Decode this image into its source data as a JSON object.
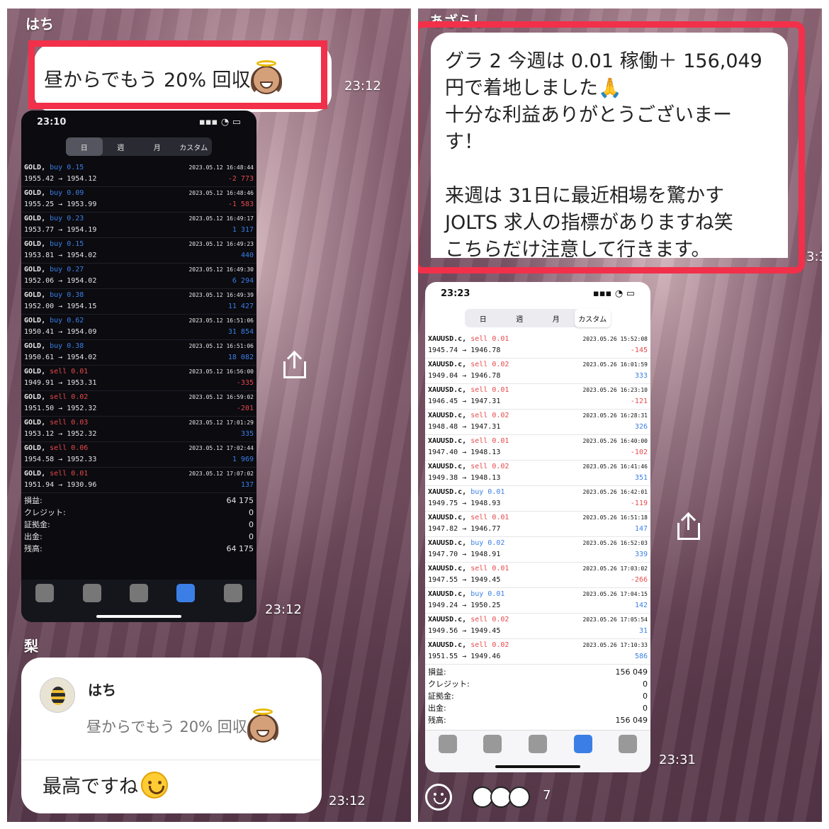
{
  "left": {
    "sender": "はち",
    "message1": "昼からでもう 20% 回収",
    "time1": "23:12",
    "phone": {
      "time": "23:10",
      "tabs": [
        "日",
        "週",
        "月",
        "カスタム"
      ],
      "rows": [
        {
          "sym": "GOLD,",
          "side": "buy 0.15",
          "dir": "buy",
          "date": "2023.05.12 16:48:44",
          "prices": "1955.42 → 1954.12",
          "pnl": "-2 773",
          "sign": "neg"
        },
        {
          "sym": "GOLD,",
          "side": "buy 0.09",
          "dir": "buy",
          "date": "2023.05.12 16:48:46",
          "prices": "1955.25 → 1953.99",
          "pnl": "-1 583",
          "sign": "neg"
        },
        {
          "sym": "GOLD,",
          "side": "buy 0.23",
          "dir": "buy",
          "date": "2023.05.12 16:49:17",
          "prices": "1953.77 → 1954.19",
          "pnl": "1 317",
          "sign": "pos"
        },
        {
          "sym": "GOLD,",
          "side": "buy 0.15",
          "dir": "buy",
          "date": "2023.05.12 16:49:23",
          "prices": "1953.81 → 1954.02",
          "pnl": "440",
          "sign": "pos"
        },
        {
          "sym": "GOLD,",
          "side": "buy 0.27",
          "dir": "buy",
          "date": "2023.05.12 16:49:30",
          "prices": "1952.06 → 1954.02",
          "pnl": "6 294",
          "sign": "pos"
        },
        {
          "sym": "GOLD,",
          "side": "buy 0.38",
          "dir": "buy",
          "date": "2023.05.12 16:49:39",
          "prices": "1952.00 → 1954.15",
          "pnl": "11 427",
          "sign": "pos"
        },
        {
          "sym": "GOLD,",
          "side": "buy 0.62",
          "dir": "buy",
          "date": "2023.05.12 16:51:06",
          "prices": "1950.41 → 1954.09",
          "pnl": "31 854",
          "sign": "pos"
        },
        {
          "sym": "GOLD,",
          "side": "buy 0.38",
          "dir": "buy",
          "date": "2023.05.12 16:51:06",
          "prices": "1950.61 → 1954.02",
          "pnl": "18 082",
          "sign": "pos"
        },
        {
          "sym": "GOLD,",
          "side": "sell 0.01",
          "dir": "sell",
          "date": "2023.05.12 16:56:00",
          "prices": "1949.91 → 1953.31",
          "pnl": "-335",
          "sign": "neg"
        },
        {
          "sym": "GOLD,",
          "side": "sell 0.02",
          "dir": "sell",
          "date": "2023.05.12 16:59:02",
          "prices": "1951.50 → 1952.32",
          "pnl": "-201",
          "sign": "neg"
        },
        {
          "sym": "GOLD,",
          "side": "sell 0.03",
          "dir": "sell",
          "date": "2023.05.12 17:01:29",
          "prices": "1953.12 → 1952.32",
          "pnl": "335",
          "sign": "pos"
        },
        {
          "sym": "GOLD,",
          "side": "sell 0.06",
          "dir": "sell",
          "date": "2023.05.12 17:02:44",
          "prices": "1954.58 → 1952.33",
          "pnl": "1 969",
          "sign": "pos"
        },
        {
          "sym": "GOLD,",
          "side": "sell 0.01",
          "dir": "sell",
          "date": "2023.05.12 17:07:02",
          "prices": "1951.94 → 1930.96",
          "pnl": "137",
          "sign": "pos"
        }
      ],
      "summary": [
        {
          "label": "損益:",
          "value": "64 175"
        },
        {
          "label": "クレジット:",
          "value": "0"
        },
        {
          "label": "証拠金:",
          "value": "0"
        },
        {
          "label": "出金:",
          "value": "0"
        },
        {
          "label": "残高:",
          "value": "64 175"
        }
      ]
    },
    "time2": "23:12",
    "sender2": "梨",
    "reply": {
      "quoted_name": "はち",
      "quoted_text": "昼からでもう 20% 回収",
      "text": "最高ですね"
    },
    "time3": "23:12"
  },
  "right": {
    "sender": "あざらし",
    "message": {
      "line1": "グラ 2 今週は 0.01 稼働＋ 156,049",
      "line2": "円で着地しました🙏",
      "line3": "十分な利益ありがとうございまー",
      "line4": "す！",
      "line5": "来週は 31日に最近相場を驚かす",
      "line6": "JOLTS 求人の指標がありますね笑",
      "line7": "こちらだけ注意して行きます。"
    },
    "time_cut": "3:3",
    "phone": {
      "time": "23:23",
      "tabs": [
        "日",
        "週",
        "月",
        "カスタム"
      ],
      "rows": [
        {
          "sym": "XAUUSD.c,",
          "side": "sell 0.01",
          "dir": "sell",
          "date": "2023.05.26 15:52:08",
          "prices": "1945.74 → 1946.78",
          "pnl": "-145",
          "sign": "neg"
        },
        {
          "sym": "XAUUSD.c,",
          "side": "sell 0.02",
          "dir": "sell",
          "date": "2023.05.26 16:01:59",
          "prices": "1949.04 → 1946.78",
          "pnl": "333",
          "sign": "pos"
        },
        {
          "sym": "XAUUSD.c,",
          "side": "sell 0.01",
          "dir": "sell",
          "date": "2023.05.26 16:23:10",
          "prices": "1946.45 → 1947.31",
          "pnl": "-121",
          "sign": "neg"
        },
        {
          "sym": "XAUUSD.c,",
          "side": "sell 0.02",
          "dir": "sell",
          "date": "2023.05.26 16:28:31",
          "prices": "1948.48 → 1947.31",
          "pnl": "326",
          "sign": "pos"
        },
        {
          "sym": "XAUUSD.c,",
          "side": "sell 0.01",
          "dir": "sell",
          "date": "2023.05.26 16:40:00",
          "prices": "1947.40 → 1948.13",
          "pnl": "-102",
          "sign": "neg"
        },
        {
          "sym": "XAUUSD.c,",
          "side": "sell 0.02",
          "dir": "sell",
          "date": "2023.05.26 16:41:46",
          "prices": "1949.38 → 1948.13",
          "pnl": "351",
          "sign": "pos"
        },
        {
          "sym": "XAUUSD.c,",
          "side": "buy 0.01",
          "dir": "buy",
          "date": "2023.05.26 16:42:01",
          "prices": "1949.75 → 1948.93",
          "pnl": "-119",
          "sign": "neg"
        },
        {
          "sym": "XAUUSD.c,",
          "side": "sell 0.01",
          "dir": "sell",
          "date": "2023.05.26 16:51:18",
          "prices": "1947.82 → 1946.77",
          "pnl": "147",
          "sign": "pos"
        },
        {
          "sym": "XAUUSD.c,",
          "side": "buy 0.02",
          "dir": "buy",
          "date": "2023.05.26 16:52:03",
          "prices": "1947.70 → 1948.91",
          "pnl": "339",
          "sign": "pos"
        },
        {
          "sym": "XAUUSD.c,",
          "side": "sell 0.01",
          "dir": "sell",
          "date": "2023.05.26 17:03:02",
          "prices": "1947.55 → 1949.45",
          "pnl": "-266",
          "sign": "neg"
        },
        {
          "sym": "XAUUSD.c,",
          "side": "buy 0.01",
          "dir": "buy",
          "date": "2023.05.26 17:04:15",
          "prices": "1949.24 → 1950.25",
          "pnl": "142",
          "sign": "pos"
        },
        {
          "sym": "XAUUSD.c,",
          "side": "sell 0.02",
          "dir": "sell",
          "date": "2023.05.26 17:05:54",
          "prices": "1949.56 → 1949.45",
          "pnl": "31",
          "sign": "pos"
        },
        {
          "sym": "XAUUSD.c,",
          "side": "sell 0.02",
          "dir": "sell",
          "date": "2023.05.26 17:10:33",
          "prices": "1951.55 → 1949.46",
          "pnl": "586",
          "sign": "pos"
        }
      ],
      "summary": [
        {
          "label": "損益:",
          "value": "156 049"
        },
        {
          "label": "クレジット:",
          "value": "0"
        },
        {
          "label": "証拠金:",
          "value": "0"
        },
        {
          "label": "出金:",
          "value": "0"
        },
        {
          "label": "残高:",
          "value": "156 049"
        }
      ]
    },
    "time2": "23:31",
    "reaction_count": "7"
  },
  "colors": {
    "highlight": "#f2304a",
    "buy": "#3b7fe6",
    "sell": "#e64a4a"
  }
}
